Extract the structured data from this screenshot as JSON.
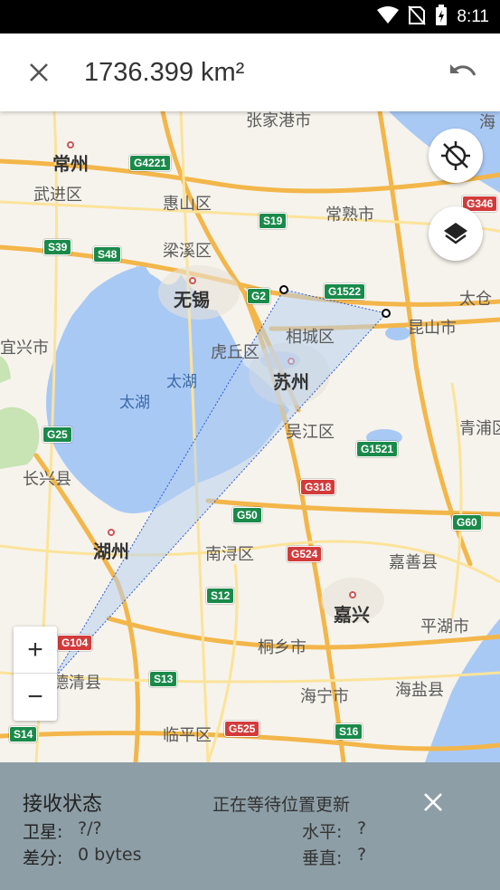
{
  "status_bar": {
    "time": "8:11"
  },
  "app_bar": {
    "title": "1736.399 km²"
  },
  "map": {
    "labels": {
      "changzhou": "常州",
      "wujin": "武进区",
      "huishan": "惠山区",
      "liangxi": "梁溪区",
      "wuxi": "无锡",
      "zhangjiagang": "张家港市",
      "changshu": "常熟市",
      "xiangcheng": "相城区",
      "huqiu": "虎丘区",
      "suzhou": "苏州",
      "taihu_1": "太湖",
      "taihu_2": "太湖",
      "yixing": "宜兴市",
      "wujiang": "吴江区",
      "kunshan": "昆山市",
      "taicang": "太仓",
      "qingpu": "青浦区",
      "changxing": "长兴县",
      "huzhou": "湖州",
      "nanxun": "南浔区",
      "jiashan": "嘉善县",
      "jiaxing": "嘉兴",
      "pinghu": "平湖市",
      "tongxiang": "桐乡市",
      "deqing": "德清县",
      "haining": "海宁市",
      "haiyan": "海盐县",
      "linping": "临平区",
      "hai": "海"
    },
    "shields": {
      "g4221": "G4221",
      "s19": "S19",
      "s39": "S39",
      "s48": "S48",
      "g2": "G2",
      "g1522": "G1522",
      "g346": "G346",
      "g25": "G25",
      "g1521": "G1521",
      "g318": "G318",
      "g50": "G50",
      "g524": "G524",
      "s12": "S12",
      "g60": "G60",
      "g104": "G104",
      "s13": "S13",
      "g525": "G525",
      "s16": "S16",
      "s14": "S14"
    },
    "zoom_in": "+",
    "zoom_out": "−",
    "colors": {
      "water": "#a9c9f5",
      "polygon_fill": "#b8d0ee",
      "polygon_stroke": "#2a5bd7"
    }
  },
  "panel": {
    "title": "接收状态",
    "status": "正在等待位置更新",
    "satellites_label": "卫星:",
    "satellites_value": "?/?",
    "diff_label": "差分:",
    "diff_value": "0 bytes",
    "horizontal_label": "水平:",
    "horizontal_value": "?",
    "vertical_label": "垂直:",
    "vertical_value": "?"
  }
}
